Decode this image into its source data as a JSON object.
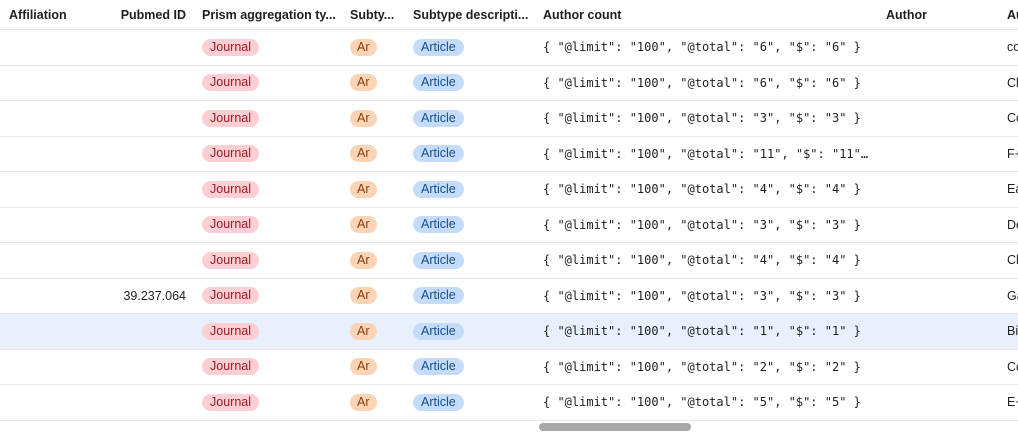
{
  "columns": {
    "affiliation": "Affiliation",
    "pubmed_id": "Pubmed ID",
    "prism_aggregation": "Prism aggregation ty...",
    "subtype": "Subty...",
    "subtype_description": "Subtype descripti...",
    "author_count": "Author count",
    "author": "Author",
    "author_overflow": "Au"
  },
  "rows": [
    {
      "affiliation": "",
      "pubmed_id": "",
      "prism": "Journal",
      "subtype": "Ar",
      "subtype_desc": "Article",
      "author_count": "{ \"@limit\": \"100\", \"@total\": \"6\", \"$\": \"6\" }",
      "author": "",
      "author_overflow": "co"
    },
    {
      "affiliation": "",
      "pubmed_id": "",
      "prism": "Journal",
      "subtype": "Ar",
      "subtype_desc": "Article",
      "author_count": "{ \"@limit\": \"100\", \"@total\": \"6\", \"$\": \"6\" }",
      "author": "",
      "author_overflow": "Cl"
    },
    {
      "affiliation": "",
      "pubmed_id": "",
      "prism": "Journal",
      "subtype": "Ar",
      "subtype_desc": "Article",
      "author_count": "{ \"@limit\": \"100\", \"@total\": \"3\", \"$\": \"3\" }",
      "author": "",
      "author_overflow": "Co"
    },
    {
      "affiliation": "",
      "pubmed_id": "",
      "prism": "Journal",
      "subtype": "Ar",
      "subtype_desc": "Article",
      "author_count": "{ \"@limit\": \"100\", \"@total\": \"11\", \"$\": \"11\"…",
      "author": "",
      "author_overflow": "F+"
    },
    {
      "affiliation": "",
      "pubmed_id": "",
      "prism": "Journal",
      "subtype": "Ar",
      "subtype_desc": "Article",
      "author_count": "{ \"@limit\": \"100\", \"@total\": \"4\", \"$\": \"4\" }",
      "author": "",
      "author_overflow": "Ea"
    },
    {
      "affiliation": "",
      "pubmed_id": "",
      "prism": "Journal",
      "subtype": "Ar",
      "subtype_desc": "Article",
      "author_count": "{ \"@limit\": \"100\", \"@total\": \"3\", \"$\": \"3\" }",
      "author": "",
      "author_overflow": "De"
    },
    {
      "affiliation": "",
      "pubmed_id": "",
      "prism": "Journal",
      "subtype": "Ar",
      "subtype_desc": "Article",
      "author_count": "{ \"@limit\": \"100\", \"@total\": \"4\", \"$\": \"4\" }",
      "author": "",
      "author_overflow": "Ch"
    },
    {
      "affiliation": "",
      "pubmed_id": "39.237.064",
      "prism": "Journal",
      "subtype": "Ar",
      "subtype_desc": "Article",
      "author_count": "{ \"@limit\": \"100\", \"@total\": \"3\", \"$\": \"3\" }",
      "author": "",
      "author_overflow": "Ga"
    },
    {
      "affiliation": "",
      "pubmed_id": "",
      "prism": "Journal",
      "subtype": "Ar",
      "subtype_desc": "Article",
      "author_count": "{ \"@limit\": \"100\", \"@total\": \"1\", \"$\": \"1\" }",
      "author": "",
      "author_overflow": "Bi",
      "selected": true
    },
    {
      "affiliation": "",
      "pubmed_id": "",
      "prism": "Journal",
      "subtype": "Ar",
      "subtype_desc": "Article",
      "author_count": "{ \"@limit\": \"100\", \"@total\": \"2\", \"$\": \"2\" }",
      "author": "",
      "author_overflow": "Co"
    },
    {
      "affiliation": "",
      "pubmed_id": "",
      "prism": "Journal",
      "subtype": "Ar",
      "subtype_desc": "Article",
      "author_count": "{ \"@limit\": \"100\", \"@total\": \"5\", \"$\": \"5\" }",
      "author": "",
      "author_overflow": "E+"
    }
  ],
  "colors": {
    "journal_chip_bg": "#fbcfd3",
    "ar_chip_bg": "#fbd3b5",
    "article_chip_bg": "#c4dcf9",
    "selected_row_bg": "#e9f0fd"
  }
}
